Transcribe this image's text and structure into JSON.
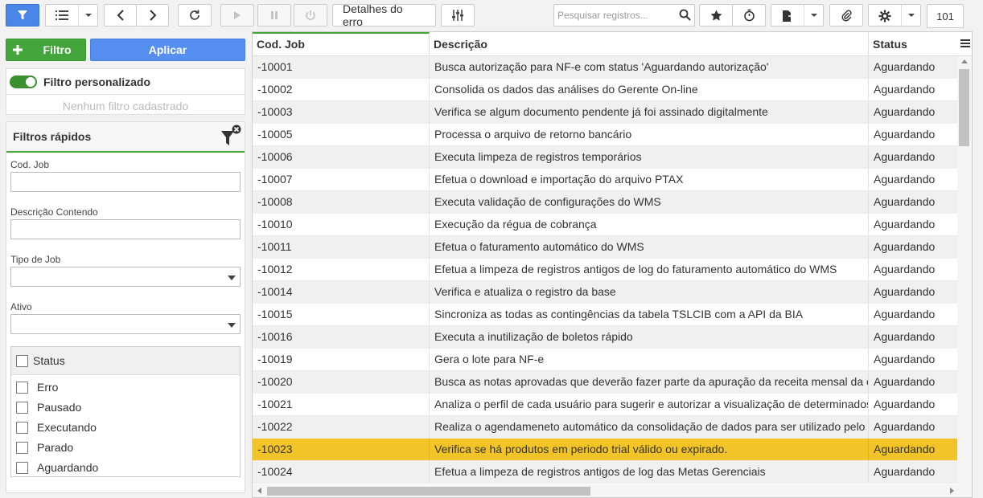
{
  "toolbar": {
    "details_label": "Detalhes do erro",
    "search_placeholder": "Pesquisar registros...",
    "record_count": "101",
    "icons": [
      "funnel-icon",
      "list-icon",
      "chevron-down-icon",
      "chevron-left-icon",
      "chevron-right-icon",
      "refresh-icon",
      "play-icon",
      "pause-icon",
      "power-icon",
      "sliders-icon",
      "search-icon",
      "star-icon",
      "stopwatch-icon",
      "export-icon",
      "paperclip-icon",
      "gear-icon"
    ]
  },
  "filter": {
    "add_label": "Filtro",
    "apply_label": "Aplicar",
    "custom_title": "Filtro personalizado",
    "custom_empty": "Nenhum filtro cadastrado",
    "quick_title": "Filtros rápidos",
    "fields": {
      "cod_job": "Cod. Job",
      "descricao": "Descrição Contendo",
      "tipo": "Tipo de Job",
      "ativo": "Ativo"
    },
    "status_title": "Status",
    "status_options": [
      "Erro",
      "Pausado",
      "Executando",
      "Parado",
      "Aguardando"
    ]
  },
  "grid": {
    "columns": [
      "Cod. Job",
      "Descrição",
      "Status"
    ],
    "selected_index": 17,
    "rows": [
      {
        "cod": "-10001",
        "desc": "Busca autorização para NF-e com status 'Aguardando autorização'",
        "status": "Aguardando"
      },
      {
        "cod": "-10002",
        "desc": "Consolida os dados das análises do Gerente On-line",
        "status": "Aguardando"
      },
      {
        "cod": "-10003",
        "desc": "Verifica se algum documento pendente já foi assinado digitalmente",
        "status": "Aguardando"
      },
      {
        "cod": "-10005",
        "desc": "Processa o arquivo de retorno bancário",
        "status": "Aguardando"
      },
      {
        "cod": "-10006",
        "desc": "Executa limpeza de registros temporários",
        "status": "Aguardando"
      },
      {
        "cod": "-10007",
        "desc": "Efetua o download e importação do arquivo PTAX",
        "status": "Aguardando"
      },
      {
        "cod": "-10008",
        "desc": "Executa validação de configurações do WMS",
        "status": "Aguardando"
      },
      {
        "cod": "-10010",
        "desc": "Execução da régua de cobrança",
        "status": "Aguardando"
      },
      {
        "cod": "-10011",
        "desc": "Efetua o faturamento automático do WMS",
        "status": "Aguardando"
      },
      {
        "cod": "-10012",
        "desc": "Efetua a limpeza de registros antigos de log do faturamento automático do WMS",
        "status": "Aguardando"
      },
      {
        "cod": "-10014",
        "desc": "Verifica e atualiza o registro da base",
        "status": "Aguardando"
      },
      {
        "cod": "-10015",
        "desc": "Sincroniza as todas as contingências da tabela TSLCIB com a API da BIA",
        "status": "Aguardando"
      },
      {
        "cod": "-10016",
        "desc": "Executa a inutilização de boletos rápido",
        "status": "Aguardando"
      },
      {
        "cod": "-10019",
        "desc": "Gera o lote para NF-e",
        "status": "Aguardando"
      },
      {
        "cod": "-10020",
        "desc": "Busca as notas aprovadas que deverão fazer parte da apuração da receita mensal da empresa",
        "status": "Aguardando"
      },
      {
        "cod": "-10021",
        "desc": "Analiza o perfil de cada usuário para sugerir e autorizar a visualização de determinados cartões",
        "status": "Aguardando"
      },
      {
        "cod": "-10022",
        "desc": "Realiza o agendameneto automático da consolidação de dados para ser utilizado pelo Sankhya",
        "status": "Aguardando"
      },
      {
        "cod": "-10023",
        "desc": "Verifica se há produtos em periodo trial válido ou expirado.",
        "status": "Aguardando"
      },
      {
        "cod": "-10024",
        "desc": "Efetua a limpeza de registros antigos de log das Metas Gerenciais",
        "status": "Aguardando"
      }
    ]
  },
  "colors": {
    "accent_green": "#43a53b",
    "accent_blue": "#5590f0",
    "selected_row": "#f2c428"
  }
}
